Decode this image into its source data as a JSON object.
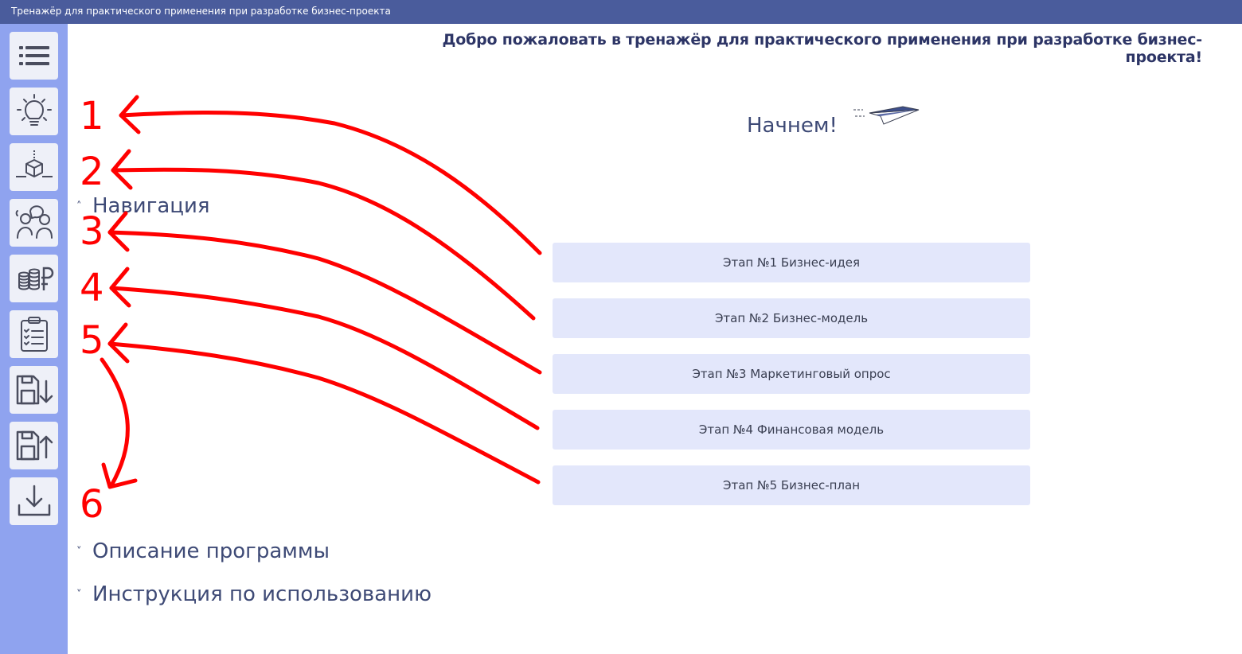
{
  "window": {
    "title": "Тренажёр для практического применения при разработке бизнес-проекта"
  },
  "sidebar": {
    "items": [
      {
        "icon": "list-icon"
      },
      {
        "icon": "lightbulb-icon"
      },
      {
        "icon": "cube-model-icon"
      },
      {
        "icon": "people-chat-icon"
      },
      {
        "icon": "coins-ruble-icon"
      },
      {
        "icon": "clipboard-checklist-icon"
      },
      {
        "icon": "save-down-icon"
      },
      {
        "icon": "save-up-icon"
      },
      {
        "icon": "download-icon"
      }
    ]
  },
  "main": {
    "welcome": "Добро пожаловать в тренажёр для практического применения при разработке бизнес-проекта!",
    "start_label": "Начнем!",
    "navigation": {
      "chevron": "˄",
      "label": "Навигация"
    },
    "stages": [
      "Этап №1 Бизнес-идея",
      "Этап №2 Бизнес-модель",
      "Этап №3 Маркетинговый опрос",
      "Этап №4 Финансовая модель",
      "Этап №5 Бизнес-план"
    ],
    "description": {
      "chevron": "˅",
      "label": "Описание программы"
    },
    "instructions": {
      "chevron": "˅",
      "label": "Инструкция по использованию"
    }
  },
  "annotations": {
    "color": "#ff0000",
    "numbers": [
      "1",
      "2",
      "3",
      "4",
      "5",
      "6"
    ]
  }
}
